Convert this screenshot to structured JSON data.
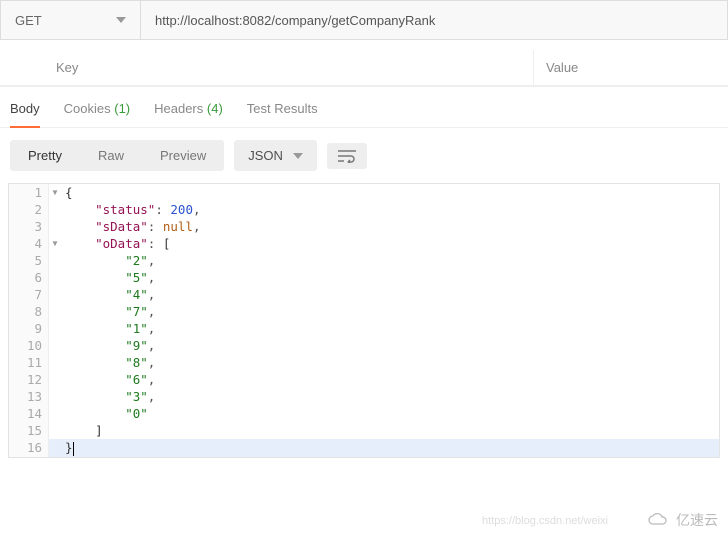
{
  "request": {
    "method": "GET",
    "url": "http://localhost:8082/company/getCompanyRank"
  },
  "params": {
    "key_placeholder": "Key",
    "value_placeholder": "Value"
  },
  "responseTabs": {
    "body": "Body",
    "cookies_label": "Cookies",
    "cookies_count": "(1)",
    "headers_label": "Headers",
    "headers_count": "(4)",
    "tests": "Test Results"
  },
  "viewModes": {
    "pretty": "Pretty",
    "raw": "Raw",
    "preview": "Preview",
    "format": "JSON"
  },
  "jsonBody": {
    "status_key": "\"status\"",
    "status_val": "200",
    "sData_key": "\"sData\"",
    "sData_val": "null",
    "oData_key": "\"oData\"",
    "items": [
      "\"2\"",
      "\"5\"",
      "\"4\"",
      "\"7\"",
      "\"1\"",
      "\"9\"",
      "\"8\"",
      "\"6\"",
      "\"3\"",
      "\"0\""
    ]
  },
  "lineNumbers": [
    "1",
    "2",
    "3",
    "4",
    "5",
    "6",
    "7",
    "8",
    "9",
    "10",
    "11",
    "12",
    "13",
    "14",
    "15",
    "16"
  ],
  "watermark": {
    "text": "亿速云",
    "url": "https://blog.csdn.net/weixi"
  }
}
